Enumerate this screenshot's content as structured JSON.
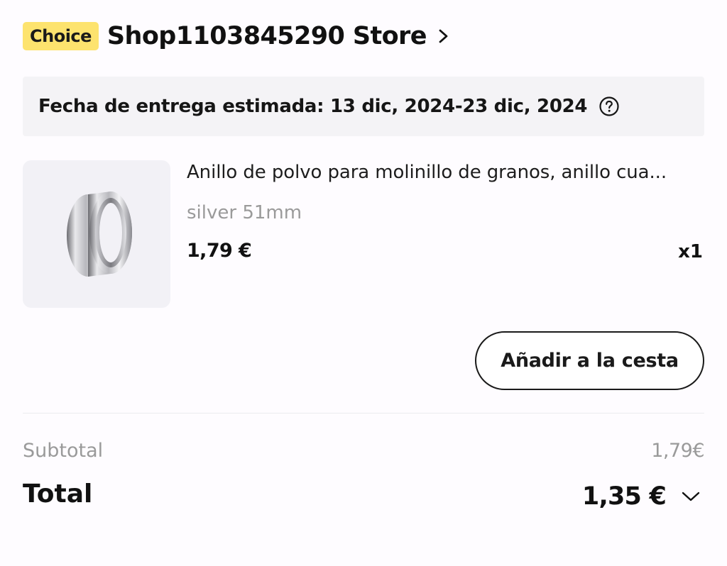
{
  "store": {
    "badge": "Choice",
    "name": "Shop1103845290 Store",
    "chevron_icon": "chevron-right-icon"
  },
  "delivery": {
    "text": "Fecha de entrega estimada: 13 dic, 2024-23 dic, 2024",
    "help_icon": "question-circle-icon"
  },
  "colors": {
    "badge_background": "#fde36e",
    "banner_background": "#f4f3f6",
    "muted_text": "#9a9a9a"
  },
  "product": {
    "image_icon": "metal-ring-product-image",
    "title": "Anillo de polvo para molinillo de granos, anillo cua...",
    "variant": "silver 51mm",
    "price": "1,79 €",
    "quantity": "x1"
  },
  "actions": {
    "add_to_cart_label": "Añadir a la cesta"
  },
  "summary": {
    "subtotal_label": "Subtotal",
    "subtotal_value": "1,79€",
    "total_label": "Total",
    "total_value": "1,35 €",
    "expand_icon": "chevron-down-icon"
  }
}
